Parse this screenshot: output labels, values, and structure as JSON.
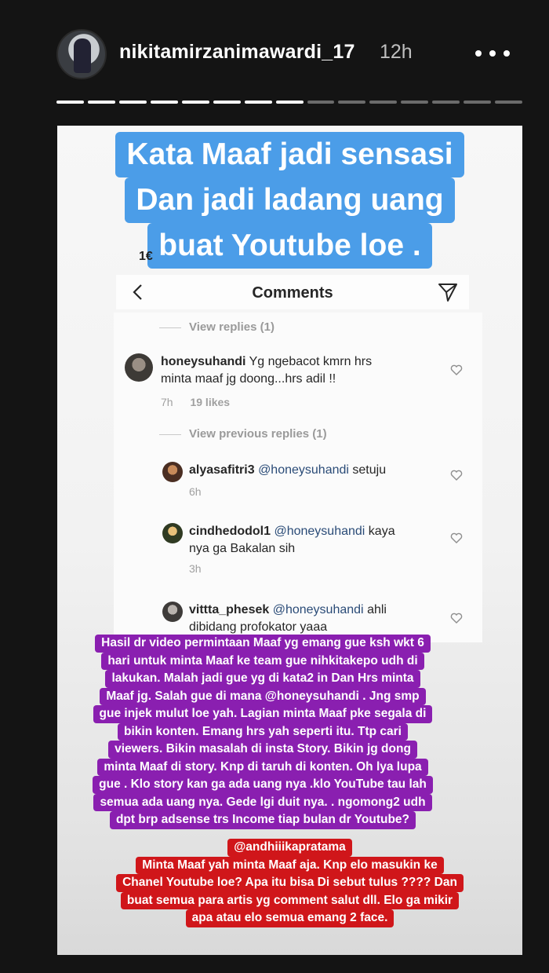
{
  "header": {
    "username": "nikitamirzanimawardi_17",
    "time_ago": "12h",
    "progress": {
      "total_segments": 15,
      "completed_segments": 8
    }
  },
  "story": {
    "caption_top": [
      "Kata Maaf jadi sensasi",
      "Dan jadi ladang uang",
      "buat Youtube loe ."
    ],
    "timestamp_fragment": "1€",
    "comments_screen": {
      "title": "Comments",
      "view_replies": "View replies (1)",
      "view_previous_replies": "View previous replies (1)",
      "main_comment": {
        "username": "honeysuhandi",
        "text": "Yg ngebacot kmrn hrs minta maaf jg doong...hrs adil !!",
        "text_line1": "Yg ngebacot kmrn hrs",
        "text_line2": "minta maaf jg doong...hrs adil !!",
        "time": "7h",
        "likes": "19 likes"
      },
      "replies": [
        {
          "username": "alyasafitri3",
          "mention": "@honeysuhandi",
          "text": "setuju",
          "time": "6h"
        },
        {
          "username": "cindhedodol1",
          "mention": "@honeysuhandi",
          "text": "kaya",
          "text_line2": "nya ga Bakalan sih",
          "time": "3h"
        },
        {
          "username": "vittta_phesek",
          "mention": "@honeysuhandi",
          "text": "ahli",
          "text_line2": "dibidang profokator yaaa"
        }
      ]
    },
    "caption_purple": [
      "Hasil dr video permintaan Maaf yg emang gue ksh wkt 6",
      "hari untuk minta Maaf ke team gue nihkitakepo udh di",
      "lakukan. Malah jadi gue yg di kata2 in Dan Hrs minta",
      "Maaf jg. Salah gue di mana @honeysuhandi . Jng smp",
      "gue injek mulut loe yah. Lagian minta Maaf pke segala di",
      "bikin konten. Emang hrs yah seperti itu. Ttp cari",
      "viewers. Bikin masalah di insta Story. Bikin jg dong",
      "minta Maaf di story. Knp di taruh di konten. Oh lya lupa",
      "gue . Klo story kan ga ada uang nya .klo YouTube tau lah",
      "semua ada uang nya. Gede lgi duit nya. . ngomong2 udh",
      "dpt brp adsense trs Income tiap bulan dr Youtube?"
    ],
    "caption_red": [
      "@andhiiikapratama",
      "Minta Maaf yah minta Maaf aja. Knp elo masukin ke",
      "Chanel Youtube loe? Apa itu bisa Di sebut tulus ???? Dan",
      "buat semua para artis yg comment salut dll. Elo ga mikir",
      "apa atau elo semua emang 2 face."
    ]
  },
  "colors": {
    "caption_blue": "#4b9de8",
    "caption_purple": "#8a1fb0",
    "caption_red": "#d0161a",
    "mention_blue": "#2a4b77"
  },
  "icons": [
    "user-avatar",
    "more-options-icon",
    "back-arrow-icon",
    "send-icon",
    "heart-icon"
  ]
}
